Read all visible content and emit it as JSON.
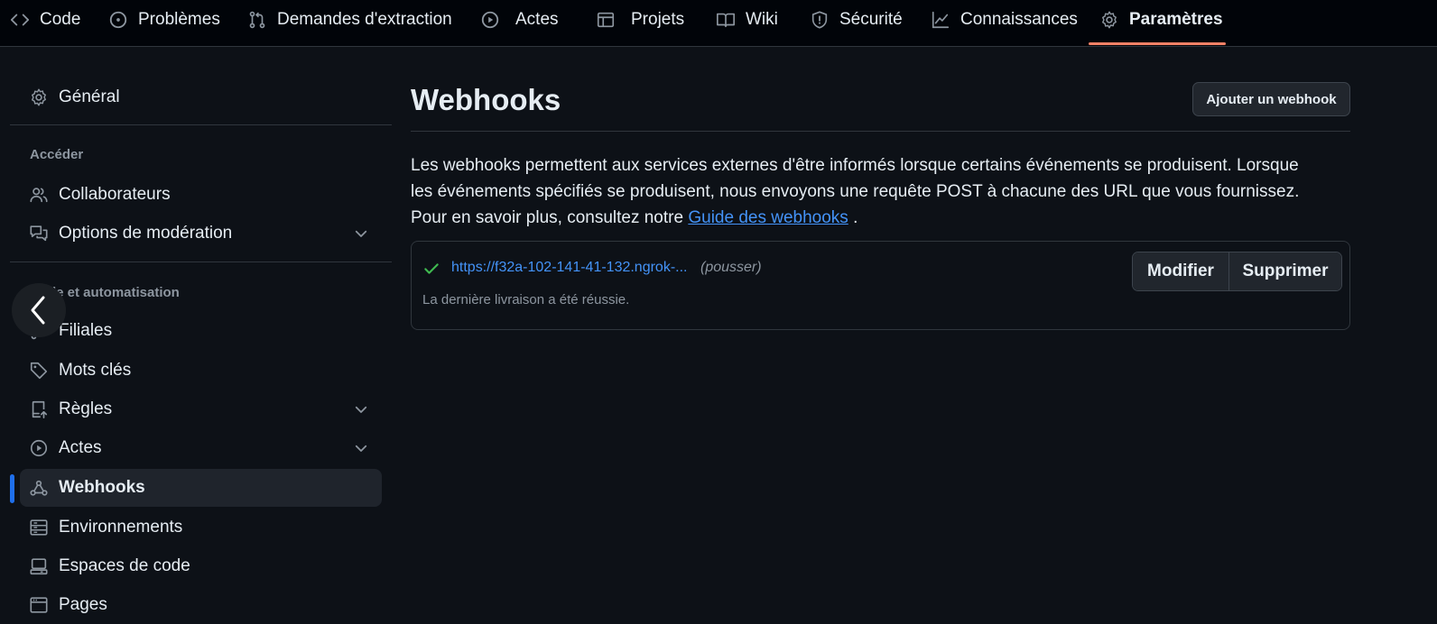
{
  "nav": {
    "tabs": [
      {
        "label": "Code",
        "icon": "code-icon"
      },
      {
        "label": "Problèmes",
        "icon": "issue-icon"
      },
      {
        "label": "Demandes d'extraction",
        "icon": "pull-request-icon"
      },
      {
        "label": "Actes",
        "icon": "play-icon"
      },
      {
        "label": "Projets",
        "icon": "table-icon"
      },
      {
        "label": "Wiki",
        "icon": "book-icon"
      },
      {
        "label": "Sécurité",
        "icon": "shield-icon"
      },
      {
        "label": "Connaissances",
        "icon": "graph-icon"
      },
      {
        "label": "Paramètres",
        "icon": "gear-icon",
        "active": true
      }
    ],
    "active_underline_color": "#f78166"
  },
  "sidebar": {
    "general": "Général",
    "access_heading": "Accéder",
    "access_items": [
      {
        "label": "Collaborateurs",
        "icon": "people-icon"
      },
      {
        "label": "Options de modération",
        "icon": "comment-discussion-icon",
        "expandable": true
      }
    ],
    "code_heading": "Code et automatisation",
    "code_items": [
      {
        "label": "Filiales",
        "icon": "branch-icon"
      },
      {
        "label": "Mots clés",
        "icon": "tag-icon"
      },
      {
        "label": "Règles",
        "icon": "repo-push-icon",
        "expandable": true
      },
      {
        "label": "Actes",
        "icon": "play-icon",
        "expandable": true
      },
      {
        "label": "Webhooks",
        "icon": "webhook-icon",
        "selected": true
      },
      {
        "label": "Environnements",
        "icon": "server-icon"
      },
      {
        "label": "Espaces de code",
        "icon": "codespaces-icon"
      },
      {
        "label": "Pages",
        "icon": "browser-icon"
      }
    ],
    "selected_marker_color": "#1f6feb"
  },
  "main": {
    "title": "Webhooks",
    "add_button": "Ajouter un webhook",
    "description_text": "Les webhooks permettent aux services externes d'être informés lorsque certains événements se produisent. Lorsque les événements spécifiés se produisent, nous envoyons une requête POST à chacune des URL que vous fournissez. Pour en savoir plus, consultez notre ",
    "description_link": "Guide des webhooks",
    "description_end": " .",
    "webhook": {
      "url": "https://f32a-102-141-41-132.ngrok-...",
      "events": "(pousser)",
      "status": "La dernière livraison a été réussie.",
      "status_color": "#3fb950",
      "edit_label": "Modifier",
      "delete_label": "Supprimer"
    }
  }
}
